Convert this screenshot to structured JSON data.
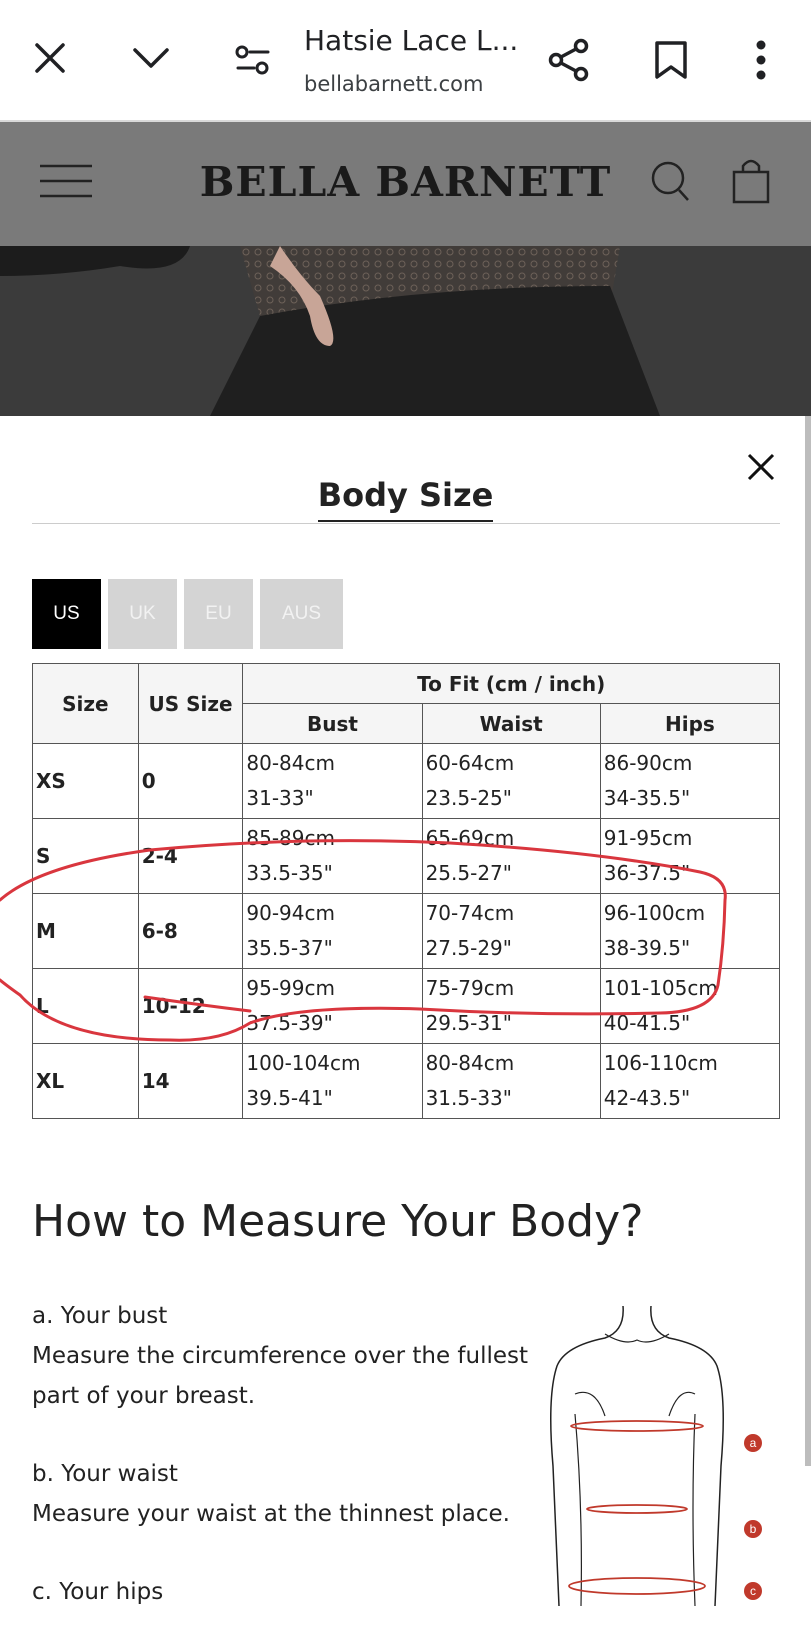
{
  "browser": {
    "tab_title": "Hatsie Lace L...",
    "url": "bellabarnett.com",
    "icons": [
      "close-icon",
      "chevron-down-icon",
      "site-settings-icon",
      "share-icon",
      "bookmark-icon",
      "more-vert-icon"
    ]
  },
  "site": {
    "brand": "BELLA BARNETT",
    "icons": [
      "hamburger-menu-icon",
      "search-icon",
      "shopping-bag-icon"
    ]
  },
  "size_chart": {
    "title": "Body Size",
    "tabs": [
      {
        "label": "US",
        "active": true
      },
      {
        "label": "UK",
        "active": false
      },
      {
        "label": "EU",
        "active": false
      },
      {
        "label": "AUS",
        "active": false
      }
    ],
    "headers": {
      "size": "Size",
      "us_size": "US Size",
      "to_fit": "To Fit (cm / inch)",
      "bust": "Bust",
      "waist": "Waist",
      "hips": "Hips"
    },
    "rows": [
      {
        "size": "XS",
        "us": "0",
        "bust": [
          "80-84cm",
          "31-33\""
        ],
        "waist": [
          "60-64cm",
          "23.5-25\""
        ],
        "hips": [
          "86-90cm",
          "34-35.5\""
        ]
      },
      {
        "size": "S",
        "us": "2-4",
        "bust": [
          "85-89cm",
          "33.5-35\""
        ],
        "waist": [
          "65-69cm",
          "25.5-27\""
        ],
        "hips": [
          "91-95cm",
          "36-37.5\""
        ]
      },
      {
        "size": "M",
        "us": "6-8",
        "bust": [
          "90-94cm",
          "35.5-37\""
        ],
        "waist": [
          "70-74cm",
          "27.5-29\""
        ],
        "hips": [
          "96-100cm",
          "38-39.5\""
        ]
      },
      {
        "size": "L",
        "us": "10-12",
        "bust": [
          "95-99cm",
          "37.5-39\""
        ],
        "waist": [
          "75-79cm",
          "29.5-31\""
        ],
        "hips": [
          "101-105cm",
          "40-41.5\""
        ]
      },
      {
        "size": "XL",
        "us": "14",
        "bust": [
          "100-104cm",
          "39.5-41\""
        ],
        "waist": [
          "80-84cm",
          "31.5-33\""
        ],
        "hips": [
          "106-110cm",
          "42-43.5\""
        ]
      }
    ]
  },
  "measure": {
    "heading": "How to Measure Your Body?",
    "items": [
      {
        "label": "a. Your bust",
        "text": "Measure the circumference over the fullest part of your breast."
      },
      {
        "label": "b. Your waist",
        "text": "Measure your waist at the thinnest place."
      },
      {
        "label": "c. Your hips",
        "text": ""
      }
    ],
    "figure_markers": [
      "a",
      "b",
      "c"
    ]
  },
  "colors": {
    "annotation": "#d9363e",
    "header_bg": "#7a7a7a",
    "tab_active": "#000000",
    "tab_inactive": "#d4d4d4"
  }
}
